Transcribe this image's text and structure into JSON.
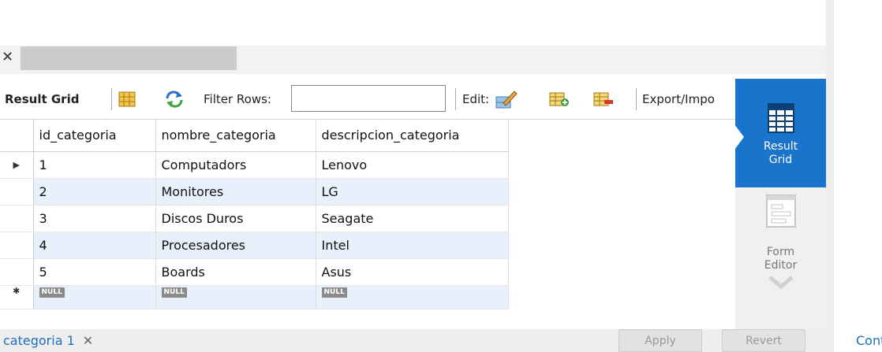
{
  "toolbar": {
    "result_grid_label": "Result Grid",
    "filter_rows_label": "Filter Rows:",
    "filter_value": "",
    "edit_label": "Edit:",
    "export_label": "Export/Impo"
  },
  "grid": {
    "columns": [
      "id_categoria",
      "nombre_categoria",
      "descripcion_categoria"
    ],
    "rows": [
      {
        "id": "1",
        "nombre": "Computadors",
        "descripcion": "Lenovo"
      },
      {
        "id": "2",
        "nombre": "Monitores",
        "descripcion": "LG"
      },
      {
        "id": "3",
        "nombre": "Discos Duros",
        "descripcion": "Seagate"
      },
      {
        "id": "4",
        "nombre": "Procesadores",
        "descripcion": "Intel"
      },
      {
        "id": "5",
        "nombre": "Boards",
        "descripcion": "Asus"
      }
    ],
    "null_label": "NULL"
  },
  "side_panel": {
    "result_grid_line1": "Result",
    "result_grid_line2": "Grid",
    "form_editor_line1": "Form",
    "form_editor_line2": "Editor"
  },
  "bottom": {
    "tab_label": "categoria 1",
    "close_glyph": "✕",
    "apply_label": "Apply",
    "revert_label": "Revert",
    "context_label": "Cont"
  },
  "colors": {
    "accent": "#1b74cb",
    "alt_row": "#e8f1fb",
    "link": "#1f6fbf"
  }
}
